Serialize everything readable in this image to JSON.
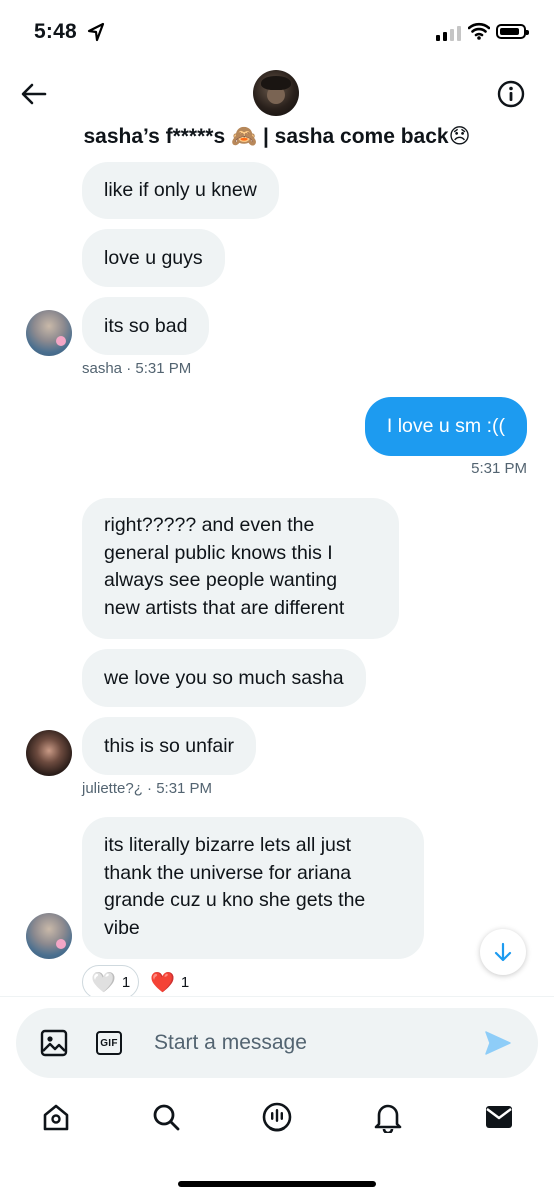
{
  "status_bar": {
    "time": "5:48"
  },
  "header": {
    "title": "sasha’s f*****s 🙈 | sasha come back😞"
  },
  "messages": [
    {
      "text": "like if only u knew"
    },
    {
      "text": "love u guys"
    },
    {
      "text": "its so bad"
    },
    {
      "meta": "sasha · 5:31 PM"
    },
    {
      "text": "I love u sm :(("
    },
    {
      "meta": "5:31 PM"
    },
    {
      "lines": [
        "right????? and even the",
        "general public knows this I",
        "always see people wanting",
        "new artists that are different"
      ]
    },
    {
      "text": "we love you so much sasha"
    },
    {
      "text": "this is so unfair"
    },
    {
      "meta": "juliette?¿ · 5:31 PM"
    },
    {
      "lines": [
        "its literally bizarre lets all just",
        "thank the universe for ariana",
        "grande cuz u kno she gets the",
        "vibe"
      ]
    }
  ],
  "reactions": [
    {
      "emoji": "🤍",
      "count": "1"
    },
    {
      "emoji": "❤️",
      "count": "1"
    }
  ],
  "composer": {
    "placeholder": "Start a message"
  },
  "icons": {
    "back": "arrow-left-icon",
    "info": "info-icon",
    "media": "image-icon",
    "gif": "GIF",
    "send": "send-icon",
    "scroll_down": "arrow-down-icon",
    "tabs": [
      "home-icon",
      "search-icon",
      "spaces-icon",
      "notifications-icon",
      "messages-icon"
    ]
  },
  "colors": {
    "accent": "#1d9bf0",
    "bubble_in": "#eff3f4",
    "meta": "#536471"
  }
}
